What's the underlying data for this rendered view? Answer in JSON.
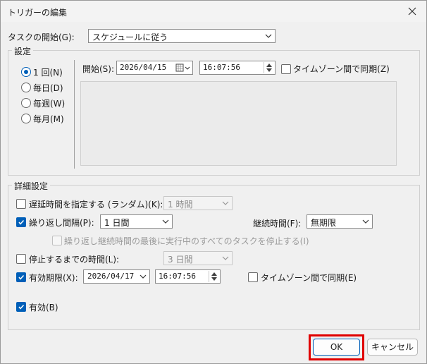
{
  "dialog": {
    "title": "トリガーの編集"
  },
  "begin": {
    "label": "タスクの開始(G):",
    "value": "スケジュールに従う"
  },
  "settings": {
    "legend": "設定",
    "radios": [
      {
        "label": "1 回(N)",
        "checked": true
      },
      {
        "label": "毎日(D)",
        "checked": false
      },
      {
        "label": "毎週(W)",
        "checked": false
      },
      {
        "label": "毎月(M)",
        "checked": false
      }
    ],
    "start_label": "開始(S):",
    "start_date": "2026/04/15",
    "start_time": "16:07:56",
    "sync_label": "タイムゾーン間で同期(Z)"
  },
  "advanced": {
    "legend": "詳細設定",
    "delay_label": "遅延時間を指定する (ランダム)(K):",
    "delay_value": "1 時間",
    "repeat_label": "繰り返し間隔(P):",
    "repeat_value": "1 日間",
    "duration_label": "継続時間(F):",
    "duration_value": "無期限",
    "stop_all_label": "繰り返し継続時間の最後に実行中のすべてのタスクを停止する(I)",
    "stop_label": "停止するまでの時間(L):",
    "stop_value": "3 日間",
    "expire_label": "有効期限(X):",
    "expire_date": "2026/04/17",
    "expire_time": "16:07:56",
    "expire_sync_label": "タイムゾーン間で同期(E)",
    "enabled_label": "有効(B)"
  },
  "buttons": {
    "ok": "OK",
    "cancel": "キャンセル"
  },
  "colors": {
    "accent": "#005fb8",
    "highlight": "#e00000"
  }
}
